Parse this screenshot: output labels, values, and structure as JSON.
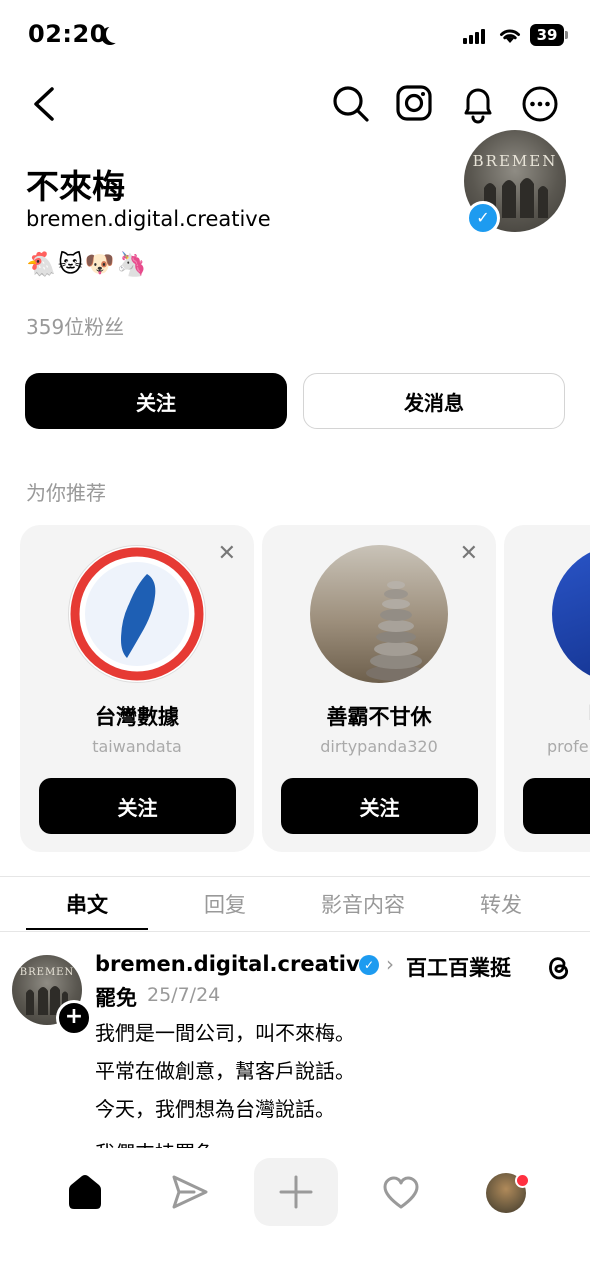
{
  "status_bar": {
    "time": "02:20",
    "battery": "39"
  },
  "profile": {
    "name": "不來梅",
    "handle": "bremen.digital.creative",
    "emojis": "🐔🐱🐶🦄",
    "followers": "359位粉丝",
    "avatar_text": "BREMEN",
    "follow_label": "关注",
    "message_label": "发消息"
  },
  "recommend": {
    "title": "为你推荐",
    "cards": [
      {
        "name": "台灣數據",
        "handle": "taiwandata",
        "button": "关注"
      },
      {
        "name": "善霸不甘休",
        "handle": "dirtypanda320",
        "button": "关注"
      },
      {
        "name": "I",
        "handle": "profe",
        "button": ""
      }
    ]
  },
  "tabs": [
    "串文",
    "回复",
    "影音内容",
    "转发"
  ],
  "post": {
    "user": "bremen.digital.creative",
    "topic_line1": "百工百業挺",
    "topic_line2": "罷免",
    "date": "25/7/24",
    "lines": [
      "我們是一間公司，叫不來梅。",
      "平常在做創意，幫客戶說話。",
      "今天，我們想為台灣說話。",
      "我們支持罷免"
    ]
  },
  "icons": {
    "header": [
      "back-icon",
      "search-icon",
      "instagram-icon",
      "bell-icon",
      "more-icon"
    ],
    "nav": [
      "home-icon",
      "send-icon",
      "plus-icon",
      "heart-icon",
      "profile-avatar"
    ]
  },
  "colors": {
    "accent": "#1d9bf0",
    "notification": "#ff3040"
  }
}
